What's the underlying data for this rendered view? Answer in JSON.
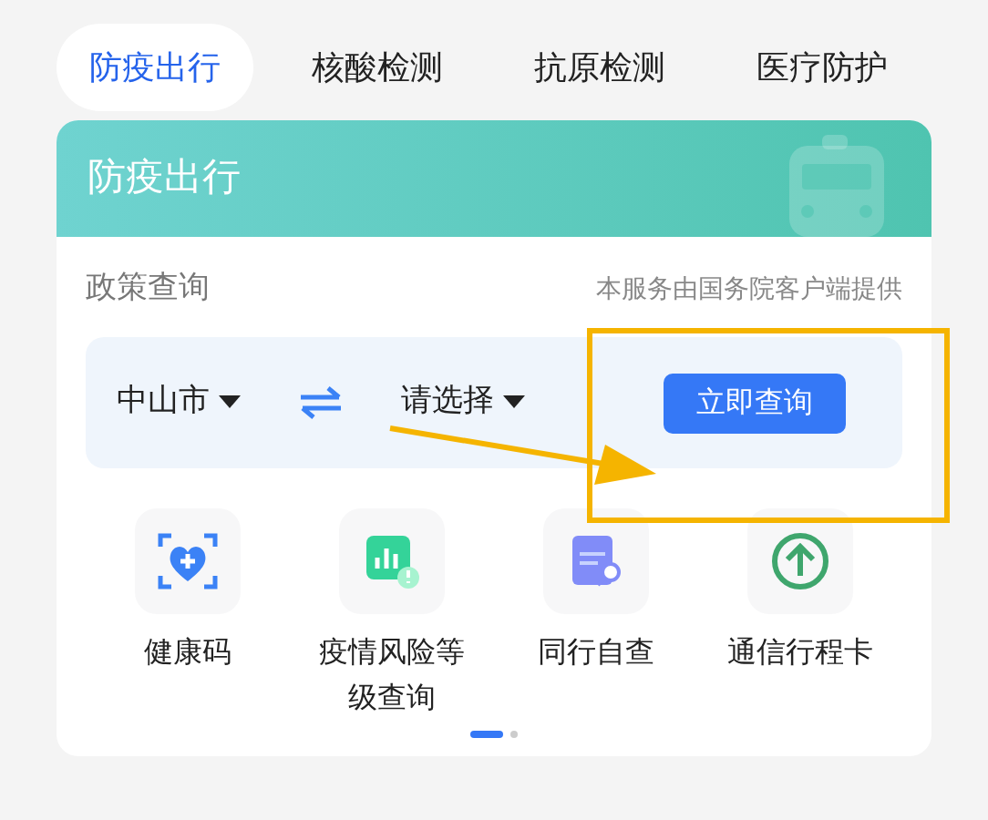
{
  "tabs": [
    {
      "label": "防疫出行",
      "selected": true
    },
    {
      "label": "核酸检测",
      "selected": false
    },
    {
      "label": "抗原检测",
      "selected": false
    },
    {
      "label": "医疗防护",
      "selected": false
    }
  ],
  "card": {
    "title": "防疫出行",
    "policy": {
      "title": "政策查询",
      "note": "本服务由国务院客户端提供"
    },
    "query": {
      "from": "中山市",
      "to": "请选择",
      "button": "立即查询"
    },
    "services": [
      {
        "kind": "health",
        "label": "健康码"
      },
      {
        "kind": "risk",
        "label": "疫情风险等级查询"
      },
      {
        "kind": "companion",
        "label": "同行自查"
      },
      {
        "kind": "trip",
        "label": "通信行程卡"
      }
    ],
    "pages": [
      {
        "selected": true
      },
      {
        "selected": false
      }
    ]
  }
}
